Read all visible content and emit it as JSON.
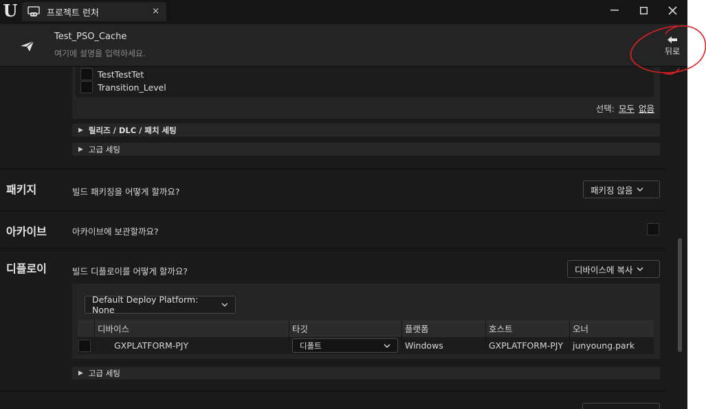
{
  "titlebar": {
    "tab_label": "프로젝트 런처",
    "tab_close": "×",
    "minimize": "—",
    "maximize": "☐",
    "close": "✕"
  },
  "project": {
    "name": "Test_PSO_Cache",
    "description": "여기에 설명을 입력하세요.",
    "back_label": "뒤로"
  },
  "maps": {
    "items": [
      {
        "label": "TestTestTet",
        "checked": false
      },
      {
        "label": "Transition_Level",
        "checked": false
      }
    ],
    "select_label": "선택:",
    "select_all": "모두",
    "select_none": "없음"
  },
  "collapsibles": {
    "release": "릴리즈 / DLC / 패치 세팅",
    "advanced": "고급 세팅",
    "advanced2": "고급 세팅"
  },
  "package": {
    "title": "패키지",
    "question": "빌드 패키징을 어떻게 할까요?",
    "dropdown": "패키징 않음"
  },
  "archive": {
    "title": "아카이브",
    "question": "아카이브에 보관할까요?",
    "checked": false
  },
  "deploy": {
    "title": "디플로이",
    "question": "빌드 디플로이를 어떻게 할까요?",
    "dropdown": "디바이스에 복사",
    "platform_dropdown": "Default Deploy Platform: None",
    "columns": [
      "디바이스",
      "타깃",
      "플랫폼",
      "호스트",
      "오너"
    ],
    "rows": [
      {
        "device": "GXPLATFORM-PJY",
        "target": "디폴트",
        "platform": "Windows",
        "host": "GXPLATFORM-PJY",
        "owner": "junyoung.park"
      }
    ]
  },
  "colors": {
    "background": "#1a1a1a",
    "panel": "#242424",
    "annotation": "#e02020"
  }
}
